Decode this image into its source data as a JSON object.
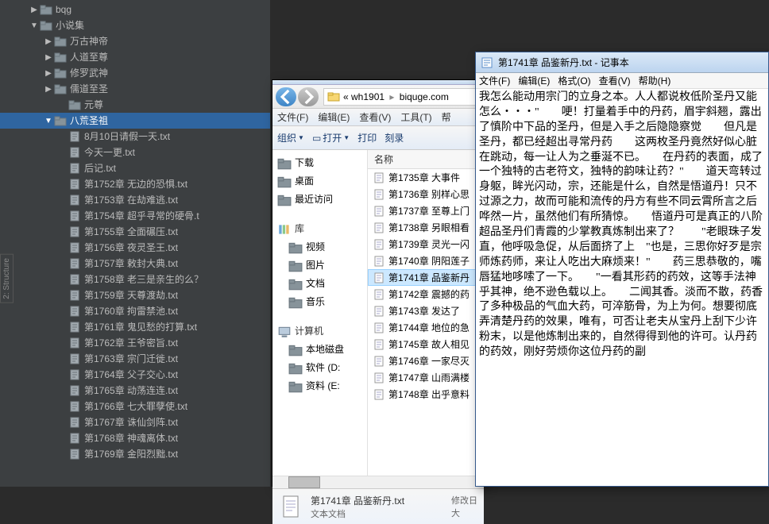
{
  "sidebar": {
    "tree": [
      {
        "depth": 2,
        "arrow": "▶",
        "type": "folder",
        "label": "bqg"
      },
      {
        "depth": 2,
        "arrow": "▼",
        "type": "folder",
        "label": "小说集"
      },
      {
        "depth": 3,
        "arrow": "▶",
        "type": "folder",
        "label": "万古神帝"
      },
      {
        "depth": 3,
        "arrow": "▶",
        "type": "folder",
        "label": "人道至尊"
      },
      {
        "depth": 3,
        "arrow": "▶",
        "type": "folder",
        "label": "修罗武神"
      },
      {
        "depth": 3,
        "arrow": "▶",
        "type": "folder",
        "label": "儒道至圣"
      },
      {
        "depth": 4,
        "arrow": "",
        "type": "folder",
        "label": "元尊"
      },
      {
        "depth": 3,
        "arrow": "▼",
        "type": "folder",
        "label": "八荒圣祖",
        "selected": true
      },
      {
        "depth": 4,
        "arrow": "",
        "type": "file",
        "label": "8月10日请假一天.txt"
      },
      {
        "depth": 4,
        "arrow": "",
        "type": "file",
        "label": "今天一更.txt"
      },
      {
        "depth": 4,
        "arrow": "",
        "type": "file",
        "label": "后记.txt"
      },
      {
        "depth": 4,
        "arrow": "",
        "type": "file",
        "label": "第1752章 无边的恐惧.txt"
      },
      {
        "depth": 4,
        "arrow": "",
        "type": "file",
        "label": "第1753章 在劫难逃.txt"
      },
      {
        "depth": 4,
        "arrow": "",
        "type": "file",
        "label": "第1754章 超乎寻常的硬骨.t"
      },
      {
        "depth": 4,
        "arrow": "",
        "type": "file",
        "label": "第1755章 全面碾压.txt"
      },
      {
        "depth": 4,
        "arrow": "",
        "type": "file",
        "label": "第1756章 夜灵圣王.txt"
      },
      {
        "depth": 4,
        "arrow": "",
        "type": "file",
        "label": "第1757章 敕封大典.txt"
      },
      {
        "depth": 4,
        "arrow": "",
        "type": "file",
        "label": "第1758章 老三是亲生的么？"
      },
      {
        "depth": 4,
        "arrow": "",
        "type": "file",
        "label": "第1759章 天尊渡劫.txt"
      },
      {
        "depth": 4,
        "arrow": "",
        "type": "file",
        "label": "第1760章 拘雷禁池.txt"
      },
      {
        "depth": 4,
        "arrow": "",
        "type": "file",
        "label": "第1761章 鬼见愁的打算.txt"
      },
      {
        "depth": 4,
        "arrow": "",
        "type": "file",
        "label": "第1762章 王爷密旨.txt"
      },
      {
        "depth": 4,
        "arrow": "",
        "type": "file",
        "label": "第1763章 宗门迁徙.txt"
      },
      {
        "depth": 4,
        "arrow": "",
        "type": "file",
        "label": "第1764章 父子交心.txt"
      },
      {
        "depth": 4,
        "arrow": "",
        "type": "file",
        "label": "第1765章 动荡连连.txt"
      },
      {
        "depth": 4,
        "arrow": "",
        "type": "file",
        "label": "第1766章 七大罪孽使.txt"
      },
      {
        "depth": 4,
        "arrow": "",
        "type": "file",
        "label": "第1767章 诛仙剑阵.txt"
      },
      {
        "depth": 4,
        "arrow": "",
        "type": "file",
        "label": "第1768章 神魂离体.txt"
      },
      {
        "depth": 4,
        "arrow": "",
        "type": "file",
        "label": "第1769章 金阳烈黜.txt"
      }
    ],
    "tab_label": "2: Structure"
  },
  "explorer": {
    "address": {
      "seg1": "wh1901",
      "sep": "▸",
      "seg2": "biquge.com"
    },
    "menu": [
      "文件(F)",
      "编辑(E)",
      "查看(V)",
      "工具(T)",
      "帮"
    ],
    "toolbar": {
      "organize": "组织",
      "open": "打开",
      "print": "打印",
      "more": "刻录"
    },
    "nav_pane": {
      "items": [
        {
          "label": "下载",
          "ic": "download"
        },
        {
          "label": "桌面",
          "ic": "desktop"
        },
        {
          "label": "最近访问",
          "ic": "recent"
        }
      ],
      "library_label": "库",
      "library_items": [
        {
          "label": "视频",
          "ic": "video"
        },
        {
          "label": "图片",
          "ic": "pic"
        },
        {
          "label": "文档",
          "ic": "doc"
        },
        {
          "label": "音乐",
          "ic": "music"
        }
      ],
      "computer_label": "计算机",
      "computer_items": [
        {
          "label": "本地磁盘",
          "ic": "disk"
        },
        {
          "label": "软件 (D:",
          "ic": "disk"
        },
        {
          "label": "资料 (E:",
          "ic": "disk"
        }
      ]
    },
    "column_header": "名称",
    "files": [
      {
        "label": "第1735章 大事件"
      },
      {
        "label": "第1736章 别样心思"
      },
      {
        "label": "第1737章 至尊上门"
      },
      {
        "label": "第1738章 另眼相看"
      },
      {
        "label": "第1739章 灵光一闪"
      },
      {
        "label": "第1740章 阴阳莲子"
      },
      {
        "label": "第1741章 品鉴新丹",
        "selected": true
      },
      {
        "label": "第1742章 震撼的药"
      },
      {
        "label": "第1743章 发达了"
      },
      {
        "label": "第1744章 地位的急"
      },
      {
        "label": "第1745章 故人相见"
      },
      {
        "label": "第1746章 一家尽灭"
      },
      {
        "label": "第1747章 山雨满楼"
      },
      {
        "label": "第1748章 出乎意料"
      }
    ],
    "detail": {
      "name": "第1741章 品鉴新丹.txt",
      "type": "文本文档",
      "meta1": "修改日",
      "meta2": "大"
    }
  },
  "notepad": {
    "title": "第1741章 品鉴新丹.txt - 记事本",
    "menu": [
      "文件(F)",
      "编辑(E)",
      "格式(O)",
      "查看(V)",
      "帮助(H)"
    ],
    "body": "我怎么能动用宗门的立身之本。人人都说枚低阶圣丹又能怎么・・・\"　　哽！打量着手中的丹药，眉宇斜翘，露出了慎阶中下品的圣丹，但是入手之后隐隐察觉　　但凡是圣丹，都已经超出寻常丹药　　这两枚圣丹竟然好似心脏在跳动，每一让人为之垂涎不已。　　在丹药的表面，成了一个独特的古老符文，独特的韵味让药？\"　　道天弯转过身躯，眸光闪动，宗，还能是什么，自然是悟道丹！只不过源之力，故而可能和流传的丹方有些不同云霄所言之后哗然一片，虽然他们有所猜惊。　　悟道丹可是真正的八阶超品圣丹们青霞的少掌教真炼制出来了？　　\"老眼珠子发直，他呼吸急促，从后面挤了上　\"也是，三思你好歹是宗师炼药师，来让人吃出大麻烦来！\"　　药三思恭敬的，嘴唇猛地哆嗦了一下。　　\"一看其形药的药效，这等手法神乎其神，绝不逊色载以上。　　二闻其香。淡而不散，药香了多种极品的气血大药，可淬筋骨，为上为何。想要彻底弄清楚丹药的效果，唯有，可否让老夫从宝丹上刮下少许粉末，以是他炼制出来的，自然得得到他的许可。认丹药的药效，刚好劳烦你这位丹药的副"
  }
}
